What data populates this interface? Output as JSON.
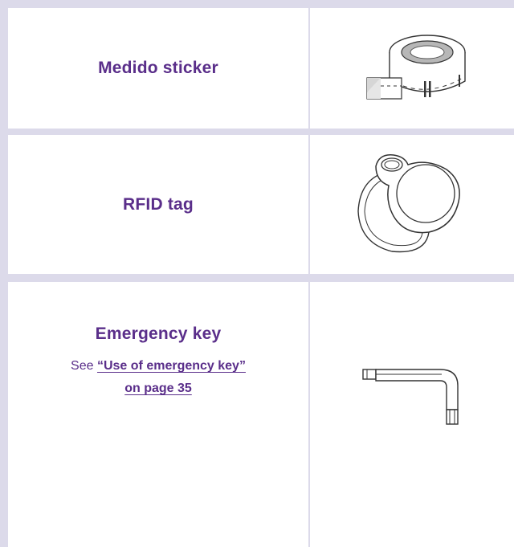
{
  "rows": [
    {
      "title": "Medido sticker",
      "icon": "sticker-roll-icon"
    },
    {
      "title": "RFID tag",
      "icon": "rfid-tag-icon"
    },
    {
      "title": "Emergency key",
      "see_prefix": "See ",
      "link_line1": "“Use of emergency key”",
      "link_line2": "on page 35",
      "icon": "emergency-key-icon"
    }
  ],
  "colors": {
    "accent": "#5a2e8a",
    "border": "#dcdaea"
  }
}
